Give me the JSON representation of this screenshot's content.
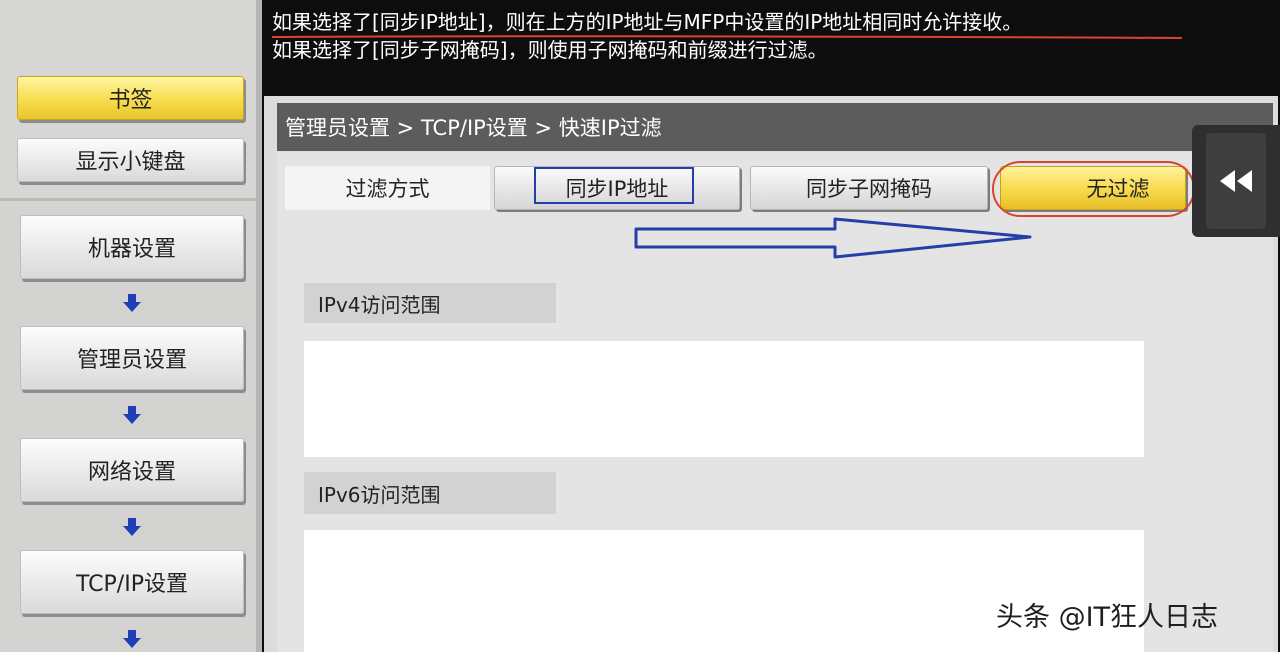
{
  "message": {
    "line1": "如果选择了[同步IP地址]，则在上方的IP地址与MFP中设置的IP地址相同时允许接收。",
    "line2": "如果选择了[同步子网掩码]，则使用子网掩码和前缀进行过滤。"
  },
  "sidebar": {
    "bookmark": "书签",
    "show_keypad": "显示小键盘",
    "nav": [
      "机器设置",
      "管理员设置",
      "网络设置",
      "TCP/IP设置"
    ]
  },
  "breadcrumb": "管理员设置 > TCP/IP设置 > 快速IP过滤",
  "tabs": {
    "filter_method": "过滤方式",
    "sync_ip": "同步IP地址",
    "sync_subnet": "同步子网掩码",
    "no_filter": "无过滤"
  },
  "sections": {
    "ipv4": "IPv4访问范围",
    "ipv6": "IPv6访问范围"
  },
  "watermark": "头条 @IT狂人日志",
  "colors": {
    "highlight_yellow": "#f7d94a",
    "annotation_blue": "#2340a8",
    "annotation_red": "#d9452b",
    "nav_arrow_blue": "#1f3fb8"
  },
  "icons": [
    "down-arrow-icon",
    "double-chevron-left-icon",
    "annotation-arrow-icon"
  ]
}
